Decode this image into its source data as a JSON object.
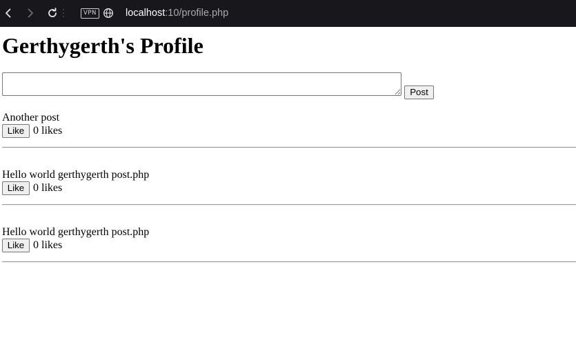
{
  "browser": {
    "vpn_label": "VPN",
    "url_host": "localhost",
    "url_rest": ":10/profile.php"
  },
  "page": {
    "title": "Gerthygerth's Profile",
    "post_input": {
      "value": "",
      "placeholder": ""
    },
    "post_button_label": "Post",
    "posts": [
      {
        "text": "Another post",
        "like_label": "Like",
        "likes": "0",
        "likes_label": "likes"
      },
      {
        "text": "Hello world gerthygerth post.php",
        "like_label": "Like",
        "likes": "0",
        "likes_label": "likes"
      },
      {
        "text": "Hello world gerthygerth post.php",
        "like_label": "Like",
        "likes": "0",
        "likes_label": "likes"
      }
    ]
  }
}
